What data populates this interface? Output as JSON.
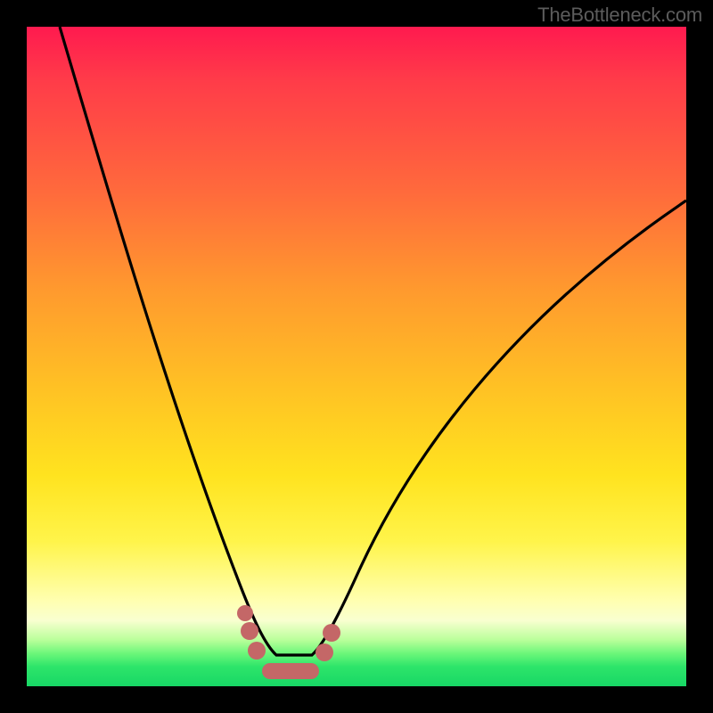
{
  "watermark": "TheBottleneck.com",
  "chart_data": {
    "type": "line",
    "title": "",
    "xlabel": "",
    "ylabel": "",
    "xlim": [
      0,
      100
    ],
    "ylim": [
      0,
      100
    ],
    "grid": false,
    "series": [
      {
        "name": "bottleneck-curve",
        "x": [
          5,
          10,
          15,
          20,
          25,
          30,
          33,
          35,
          37,
          39,
          41,
          43,
          48,
          55,
          65,
          75,
          85,
          95,
          100
        ],
        "y": [
          100,
          82,
          66,
          50,
          36,
          22,
          12,
          6,
          2,
          2,
          2,
          6,
          14,
          26,
          40,
          52,
          62,
          70,
          74
        ]
      }
    ],
    "annotations": [
      {
        "type": "marker-cluster",
        "shape": "rounded",
        "color": "#c76262",
        "x_range": [
          34,
          44
        ],
        "y_range": [
          1,
          9
        ]
      }
    ],
    "gradient_stops": [
      {
        "pos": 0.0,
        "color": "#ff1a4f"
      },
      {
        "pos": 0.4,
        "color": "#ff9a2e"
      },
      {
        "pos": 0.7,
        "color": "#ffe31f"
      },
      {
        "pos": 0.9,
        "color": "#f9ffd0"
      },
      {
        "pos": 1.0,
        "color": "#17d765"
      }
    ]
  }
}
